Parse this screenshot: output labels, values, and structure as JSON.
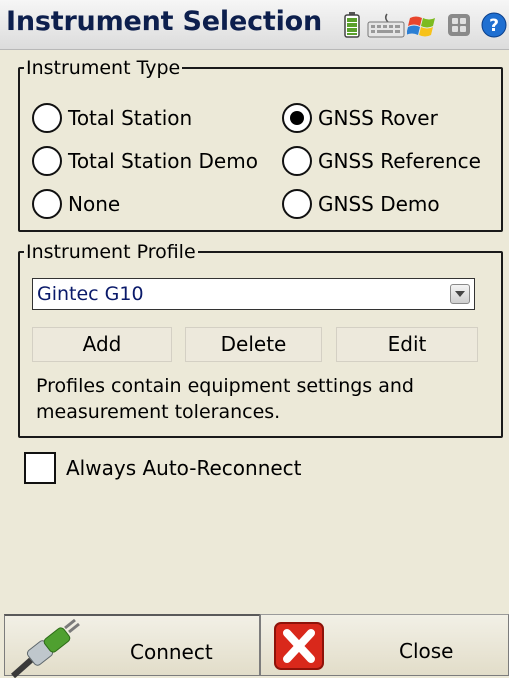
{
  "window": {
    "title": "Instrument Selection"
  },
  "tray_icons": [
    "battery-icon",
    "keyboard-icon",
    "windows-flag-icon",
    "app-grid-icon",
    "help-icon"
  ],
  "instrument_type": {
    "label": "Instrument Type",
    "options": [
      {
        "label": "Total Station",
        "selected": false
      },
      {
        "label": "GNSS Rover",
        "selected": true
      },
      {
        "label": "Total Station Demo",
        "selected": false
      },
      {
        "label": "GNSS Reference",
        "selected": false
      },
      {
        "label": "None",
        "selected": false
      },
      {
        "label": "GNSS Demo",
        "selected": false
      }
    ]
  },
  "instrument_profile": {
    "label": "Instrument Profile",
    "selected_profile": "Gintec G10",
    "buttons": {
      "add": "Add",
      "delete": "Delete",
      "edit": "Edit"
    },
    "note": "Profiles contain equipment settings and measurement tolerances."
  },
  "auto_reconnect": {
    "label": "Always Auto-Reconnect",
    "checked": false
  },
  "footer": {
    "connect": "Connect",
    "close": "Close"
  },
  "colors": {
    "title": "#0d1f4d",
    "background": "#ece9d8",
    "close_red": "#d9281b",
    "connect_green": "#3f8a2a"
  }
}
